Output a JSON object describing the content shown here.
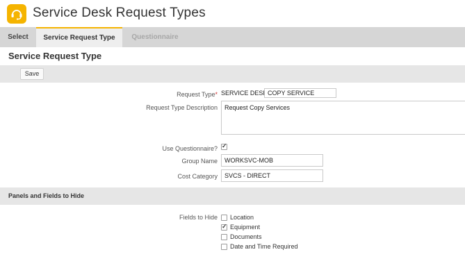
{
  "header": {
    "title": "Service Desk Request Types",
    "icon": "headset-icon",
    "icon_color": "#f5b400"
  },
  "tabs": [
    {
      "label": "Select",
      "state": "normal"
    },
    {
      "label": "Service Request Type",
      "state": "active"
    },
    {
      "label": "Questionnaire",
      "state": "disabled"
    }
  ],
  "section": {
    "title": "Service Request Type",
    "save_label": "Save"
  },
  "form": {
    "request_type": {
      "label": "Request Type",
      "required_mark": "*",
      "prefix": "SERVICE DESK -",
      "value": "COPY SERVICE"
    },
    "description": {
      "label": "Request Type Description",
      "value": "Request Copy Services"
    },
    "use_questionnaire": {
      "label": "Use Questionnaire?",
      "checked": true
    },
    "group_name": {
      "label": "Group Name",
      "value": "WORKSVC-MOB"
    },
    "cost_category": {
      "label": "Cost Category",
      "value": "SVCS - DIRECT"
    }
  },
  "panels": {
    "title": "Panels and Fields to Hide",
    "fields_label": "Fields to Hide",
    "fields": [
      {
        "label": "Location",
        "checked": false
      },
      {
        "label": "Equipment",
        "checked": true
      },
      {
        "label": "Documents",
        "checked": false
      },
      {
        "label": "Date and Time Required",
        "checked": false
      }
    ]
  },
  "colors": {
    "accent": "#f5b400",
    "tabbar": "#d6d6d6",
    "toolbar": "#e6e6e6"
  }
}
